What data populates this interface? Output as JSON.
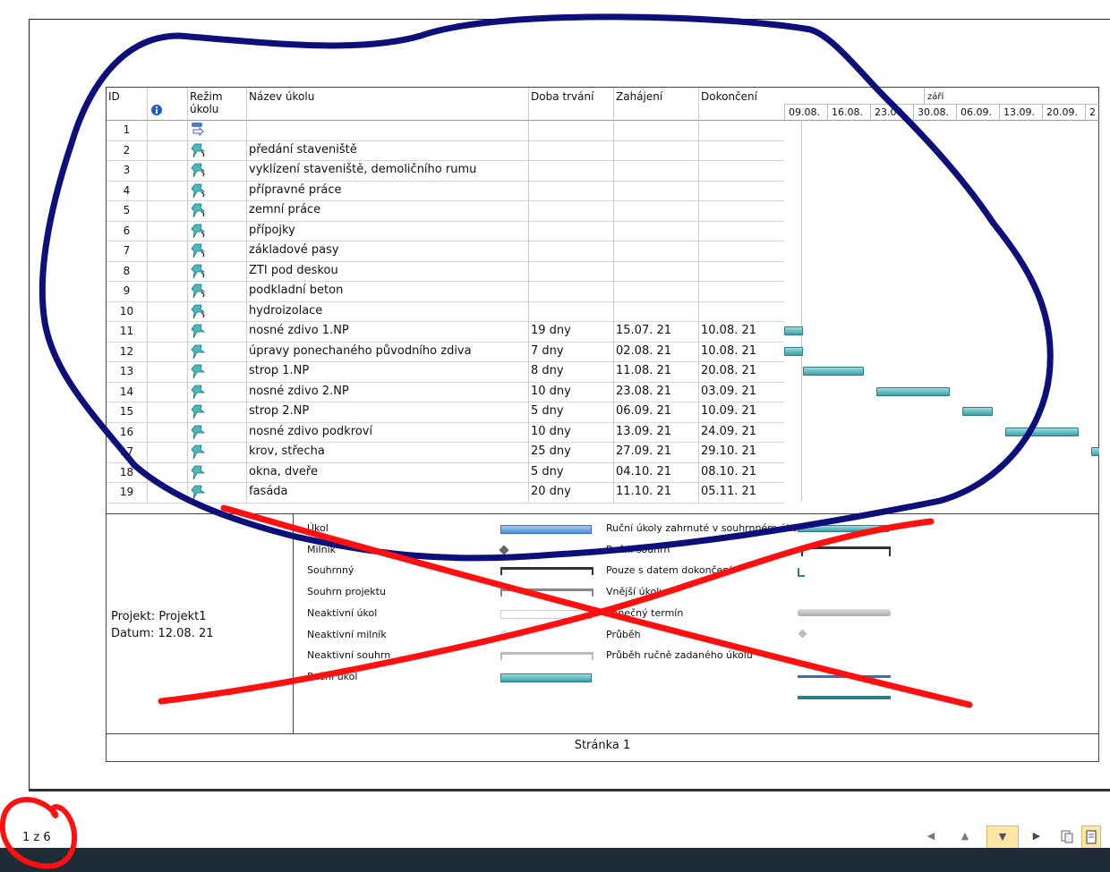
{
  "columns": {
    "id": "ID",
    "mode_line1": "Režim",
    "mode_line2": "úkolu",
    "name": "Název úkolu",
    "duration": "Doba trvání",
    "start": "Zahájení",
    "end": "Dokončení"
  },
  "timeline": {
    "month": "září",
    "weeks": [
      "09.08.",
      "16.08.",
      "23.08.",
      "30.08.",
      "06.09.",
      "13.09.",
      "20.09.",
      "2"
    ]
  },
  "tasks": [
    {
      "id": "1",
      "name": "",
      "duration": "",
      "start": "",
      "end": ""
    },
    {
      "id": "2",
      "name": "předání staveniště",
      "duration": "",
      "start": "",
      "end": ""
    },
    {
      "id": "3",
      "name": "vyklízení staveniště, demoličního rumu",
      "duration": "",
      "start": "",
      "end": ""
    },
    {
      "id": "4",
      "name": "přípravné práce",
      "duration": "",
      "start": "",
      "end": ""
    },
    {
      "id": "5",
      "name": "zemní práce",
      "duration": "",
      "start": "",
      "end": ""
    },
    {
      "id": "6",
      "name": "přípojky",
      "duration": "",
      "start": "",
      "end": ""
    },
    {
      "id": "7",
      "name": "základové pasy",
      "duration": "",
      "start": "",
      "end": ""
    },
    {
      "id": "8",
      "name": "ZTI pod deskou",
      "duration": "",
      "start": "",
      "end": ""
    },
    {
      "id": "9",
      "name": "podkladní beton",
      "duration": "",
      "start": "",
      "end": ""
    },
    {
      "id": "10",
      "name": "hydroizolace",
      "duration": "",
      "start": "",
      "end": ""
    },
    {
      "id": "11",
      "name": "nosné zdivo 1.NP",
      "duration": "19 dny",
      "start": "15.07. 21",
      "end": "10.08. 21"
    },
    {
      "id": "12",
      "name": "úpravy ponechaného původního zdiva",
      "duration": "7 dny",
      "start": "02.08. 21",
      "end": "10.08. 21"
    },
    {
      "id": "13",
      "name": "strop 1.NP",
      "duration": "8 dny",
      "start": "11.08. 21",
      "end": "20.08. 21"
    },
    {
      "id": "14",
      "name": "nosné zdivo 2.NP",
      "duration": "10 dny",
      "start": "23.08. 21",
      "end": "03.09. 21"
    },
    {
      "id": "15",
      "name": "strop 2.NP",
      "duration": "5 dny",
      "start": "06.09. 21",
      "end": "10.09. 21"
    },
    {
      "id": "16",
      "name": "nosné zdivo podkroví",
      "duration": "10 dny",
      "start": "13.09. 21",
      "end": "24.09. 21"
    },
    {
      "id": "17",
      "name": "krov, střecha",
      "duration": "25 dny",
      "start": "27.09. 21",
      "end": "29.10. 21"
    },
    {
      "id": "18",
      "name": "okna, dveře",
      "duration": "5 dny",
      "start": "04.10. 21",
      "end": "08.10. 21"
    },
    {
      "id": "19",
      "name": "fasáda",
      "duration": "20 dny",
      "start": "11.10. 21",
      "end": "05.11. 21"
    }
  ],
  "legend": {
    "project_label": "Projekt: Projekt1",
    "date_label": "Datum: 12.08. 21",
    "left": [
      "Úkol",
      "Milník",
      "Souhrnný",
      "Souhrn projektu",
      "Neaktivní úkol",
      "Neaktivní milník",
      "Neaktivní souhrn",
      "Ruční úkol"
    ],
    "right": [
      "Ruční úkoly zahrnuté v souhrnném úkolu",
      "Ruční souhrn",
      "Pouze s datem dokončení",
      "Vnější úkoly",
      "Konečný termín",
      "Průběh",
      "Průběh ručně zadaného úkolu"
    ]
  },
  "footer": {
    "page_label": "Stránka 1"
  },
  "status": {
    "page_count": "1 z 6"
  },
  "colors": {
    "bar": "#3aa0a8",
    "blue_annotation": "#0d0f7a",
    "red_annotation": "#ff1010"
  }
}
